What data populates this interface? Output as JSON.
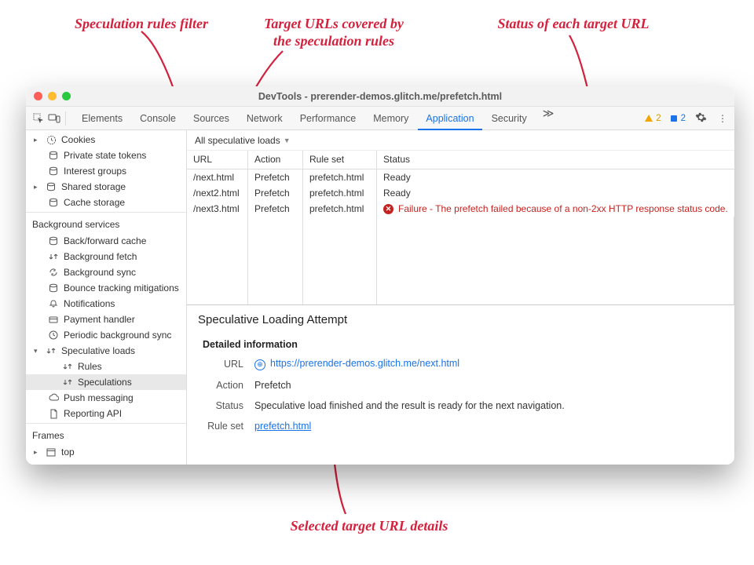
{
  "annotations": {
    "top_left": "Speculation rules filter",
    "top_mid_l1": "Target URLs covered by",
    "top_mid_l2": "the speculation rules",
    "top_right": "Status of each target URL",
    "bottom": "Selected target URL details"
  },
  "window": {
    "title": "DevTools - prerender-demos.glitch.me/prefetch.html"
  },
  "tabs": [
    "Elements",
    "Console",
    "Sources",
    "Network",
    "Performance",
    "Memory",
    "Application",
    "Security"
  ],
  "active_tab": "Application",
  "indicators": {
    "warnings": "2",
    "issues": "2"
  },
  "sidebar": {
    "storage": [
      {
        "label": "Cookies",
        "icon": "clock",
        "expandable": true
      },
      {
        "label": "Private state tokens",
        "icon": "db"
      },
      {
        "label": "Interest groups",
        "icon": "db"
      },
      {
        "label": "Shared storage",
        "icon": "db",
        "expandable": true
      },
      {
        "label": "Cache storage",
        "icon": "db"
      }
    ],
    "bg_heading": "Background services",
    "bg": [
      {
        "label": "Back/forward cache",
        "icon": "db"
      },
      {
        "label": "Background fetch",
        "icon": "arrows"
      },
      {
        "label": "Background sync",
        "icon": "sync"
      },
      {
        "label": "Bounce tracking mitigations",
        "icon": "db"
      },
      {
        "label": "Notifications",
        "icon": "bell"
      },
      {
        "label": "Payment handler",
        "icon": "card"
      },
      {
        "label": "Periodic background sync",
        "icon": "clock"
      },
      {
        "label": "Speculative loads",
        "icon": "arrows",
        "expanded": true
      },
      {
        "label": "Rules",
        "icon": "arrows",
        "sub": true
      },
      {
        "label": "Speculations",
        "icon": "arrows",
        "sub": true,
        "selected": true
      },
      {
        "label": "Push messaging",
        "icon": "cloud"
      },
      {
        "label": "Reporting API",
        "icon": "page"
      }
    ],
    "frames_heading": "Frames",
    "frames": [
      {
        "label": "top",
        "icon": "frame",
        "expandable": true
      }
    ]
  },
  "filter": {
    "label": "All speculative loads"
  },
  "columns": {
    "url": "URL",
    "action": "Action",
    "ruleset": "Rule set",
    "status": "Status"
  },
  "rows": [
    {
      "url": "/next.html",
      "action": "Prefetch",
      "ruleset": "prefetch.html",
      "status": "Ready"
    },
    {
      "url": "/next2.html",
      "action": "Prefetch",
      "ruleset": "prefetch.html",
      "status": "Ready"
    },
    {
      "url": "/next3.html",
      "action": "Prefetch",
      "ruleset": "prefetch.html",
      "status_err": "Failure - The prefetch failed because of a non-2xx HTTP response status code."
    }
  ],
  "detail": {
    "heading": "Speculative Loading Attempt",
    "sub": "Detailed information",
    "url_label": "URL",
    "url": "https://prerender-demos.glitch.me/next.html",
    "action_label": "Action",
    "action": "Prefetch",
    "status_label": "Status",
    "status": "Speculative load finished and the result is ready for the next navigation.",
    "ruleset_label": "Rule set",
    "ruleset": "prefetch.html"
  }
}
